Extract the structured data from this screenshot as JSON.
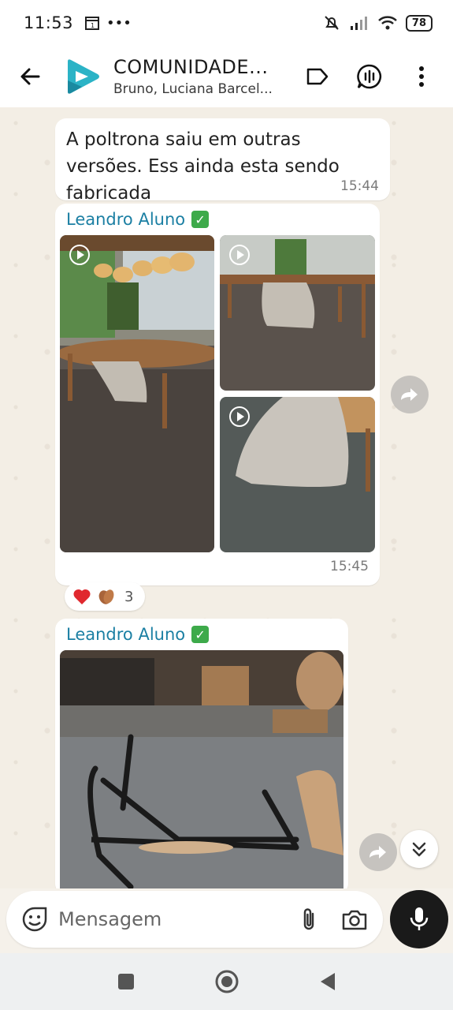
{
  "status_bar": {
    "time": "11:53",
    "battery": "78"
  },
  "header": {
    "title": "COMUNIDADE...",
    "subtitle": "Bruno, Luciana Barcel..."
  },
  "messages": [
    {
      "text": "A poltrona saiu em outras versões. Ess ainda esta sendo fabricada",
      "time": "15:44"
    },
    {
      "sender": "Leandro Aluno",
      "time": "15:45",
      "reactions": {
        "emojis": [
          "heart",
          "clapping-hands"
        ],
        "count": "3"
      }
    },
    {
      "sender": "Leandro Aluno"
    }
  ],
  "composer": {
    "placeholder": "Mensagem"
  },
  "colors": {
    "sender": "#1b7fa3",
    "verified": "#3daa4a",
    "chat_bg": "#f3eee5"
  }
}
